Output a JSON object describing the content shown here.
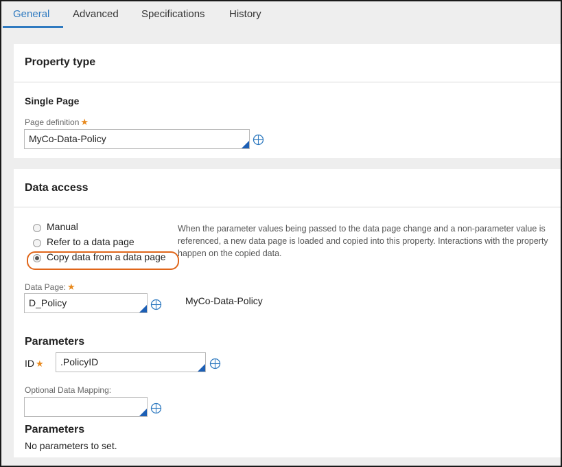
{
  "tabs": [
    "General",
    "Advanced",
    "Specifications",
    "History"
  ],
  "property_type": {
    "title": "Property type",
    "mode": "Single Page",
    "page_definition_label": "Page definition",
    "page_definition_value": "MyCo-Data-Policy"
  },
  "data_access": {
    "title": "Data access",
    "options": [
      "Manual",
      "Refer to a data page",
      "Copy data from a data page"
    ],
    "selected_option": "Copy data from a data page",
    "description": "When the parameter values being passed to the data page change and a non-parameter value is referenced, a new data page is loaded and copied into this property. Interactions with the property happen on the copied data.",
    "data_page_label": "Data Page:",
    "data_page_value": "D_Policy",
    "data_page_class": "MyCo-Data-Policy",
    "parameters_heading": "Parameters",
    "param_id_label": "ID",
    "param_id_value": ".PolicyID",
    "optional_mapping_label": "Optional Data Mapping:",
    "optional_mapping_value": "",
    "parameters_heading_2": "Parameters",
    "no_parameters_text": "No parameters to set."
  },
  "required_marker": "★",
  "colors": {
    "accent": "#2f7ac0",
    "required": "#e8891d",
    "highlight": "#e0661a"
  }
}
